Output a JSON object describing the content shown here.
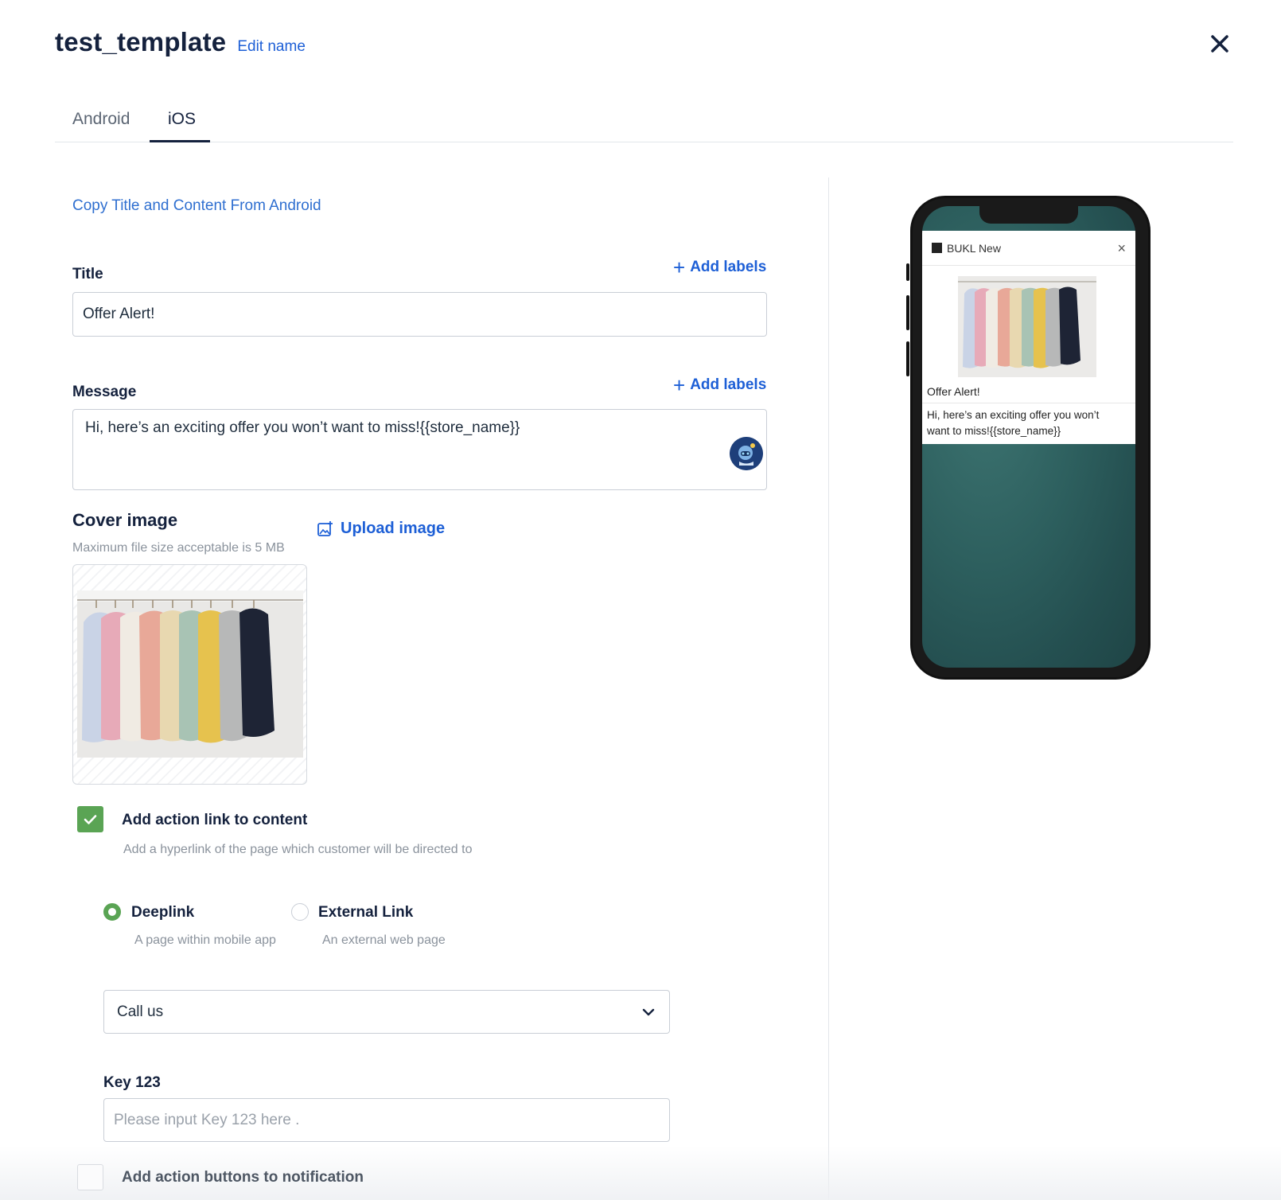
{
  "header": {
    "title": "test_template",
    "edit_name": "Edit name",
    "close_icon": "close-icon"
  },
  "tabs": [
    {
      "label": "Android",
      "active": false
    },
    {
      "label": "iOS",
      "active": true
    }
  ],
  "form": {
    "copy_link": "Copy Title and Content From Android",
    "title": {
      "label": "Title",
      "add_labels": "Add labels",
      "value": "Offer Alert!"
    },
    "message": {
      "label": "Message",
      "add_labels": "Add labels",
      "value": "Hi, here’s an exciting offer you won’t want to miss!{{store_name}}"
    },
    "cover_image": {
      "label": "Cover image",
      "note": "Maximum file size acceptable is 5 MB",
      "upload_label": "Upload image"
    },
    "action_link": {
      "checked": true,
      "label": "Add action link to content",
      "description": "Add a hyperlink of the page which customer will be directed to",
      "options": [
        {
          "label": "Deeplink",
          "description": "A page within mobile app",
          "selected": true
        },
        {
          "label": "External Link",
          "description": "An external web page",
          "selected": false
        }
      ],
      "selected_page": "Call us",
      "key_label": "Key 123",
      "key_placeholder": "Please input Key 123 here ."
    },
    "action_buttons": {
      "checked": false,
      "label": "Add action buttons to notification"
    }
  },
  "preview": {
    "app_name": "BUKL New",
    "title": "Offer Alert!",
    "message": "Hi, here’s an exciting offer you won’t want to miss!{{store_name}}"
  },
  "colors": {
    "accent": "#1d5fd6",
    "check_green": "#5aa454",
    "title_navy": "#14213d",
    "phone_wallpaper": "#2d5f5e"
  }
}
